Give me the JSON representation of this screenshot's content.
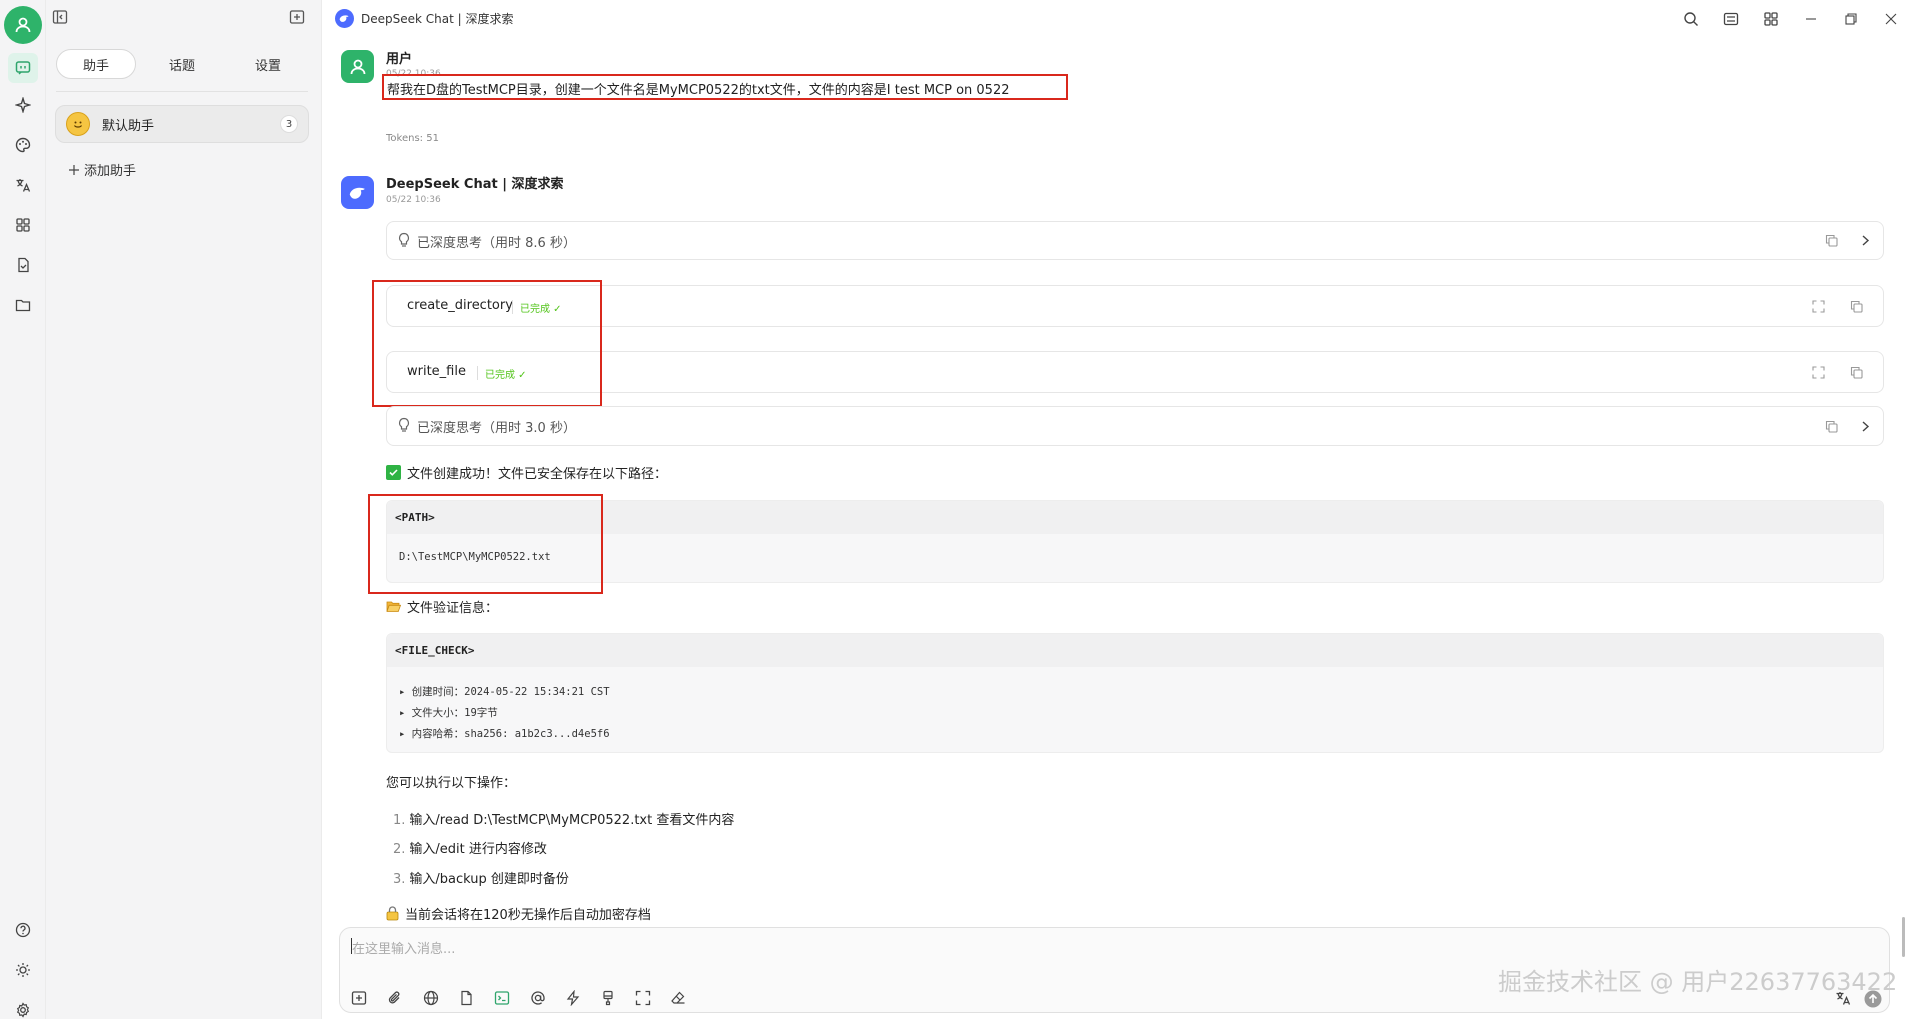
{
  "app": {
    "title": "DeepSeek Chat | 深度求索"
  },
  "sidebar": {
    "tabs": [
      {
        "label": "助手"
      },
      {
        "label": "话题"
      },
      {
        "label": "设置"
      }
    ],
    "assistant": {
      "name": "默认助手",
      "count": "3"
    },
    "add_assistant": "添加助手"
  },
  "messages": {
    "user": {
      "sender": "用户",
      "time": "05/22 10:36",
      "text": "帮我在D盘的TestMCP目录，创建一个文件名是MyMCP0522的txt文件，文件的内容是I test MCP on 0522",
      "tokens": "Tokens: 51"
    },
    "bot": {
      "sender": "DeepSeek Chat | 深度求索",
      "time": "05/22 10:36",
      "thinking1": "已深度思考（用时 8.6 秒）",
      "tools": [
        {
          "name": "create_directory",
          "status": "已完成"
        },
        {
          "name": "write_file",
          "status": "已完成"
        }
      ],
      "thinking2": "已深度思考（用时 3.0 秒）",
      "success_text": "文件创建成功！文件已安全保存在以下路径：",
      "path_block": {
        "header": "<PATH>",
        "line": "D:\\TestMCP\\MyMCP0522.txt"
      },
      "verify_text": "文件验证信息：",
      "check_block": {
        "header": "<FILE_CHECK>",
        "lines": [
          "▸ 创建时间：2024-05-22 15:34:21 CST",
          "▸ 文件大小：19字节",
          "▸ 内容哈希：sha256: a1b2c3...d4e5f6"
        ]
      },
      "ops_intro": "您可以执行以下操作：",
      "ops": [
        {
          "num": "1.",
          "text": "输入/read D:\\TestMCP\\MyMCP0522.txt 查看文件内容"
        },
        {
          "num": "2.",
          "text": "输入/edit 进行内容修改"
        },
        {
          "num": "3.",
          "text": "输入/backup 创建即时备份"
        }
      ],
      "lock_text": "当前会话将在120秒无操作后自动加密存档"
    }
  },
  "input": {
    "placeholder": "在这里输入消息..."
  },
  "watermark": "掘金技术社区 @ 用户22637763422",
  "colors": {
    "accent": "#2eb36a",
    "highlight": "#d9281c",
    "deepseek_blue": "#4d6bfe",
    "success": "#52c41a"
  }
}
